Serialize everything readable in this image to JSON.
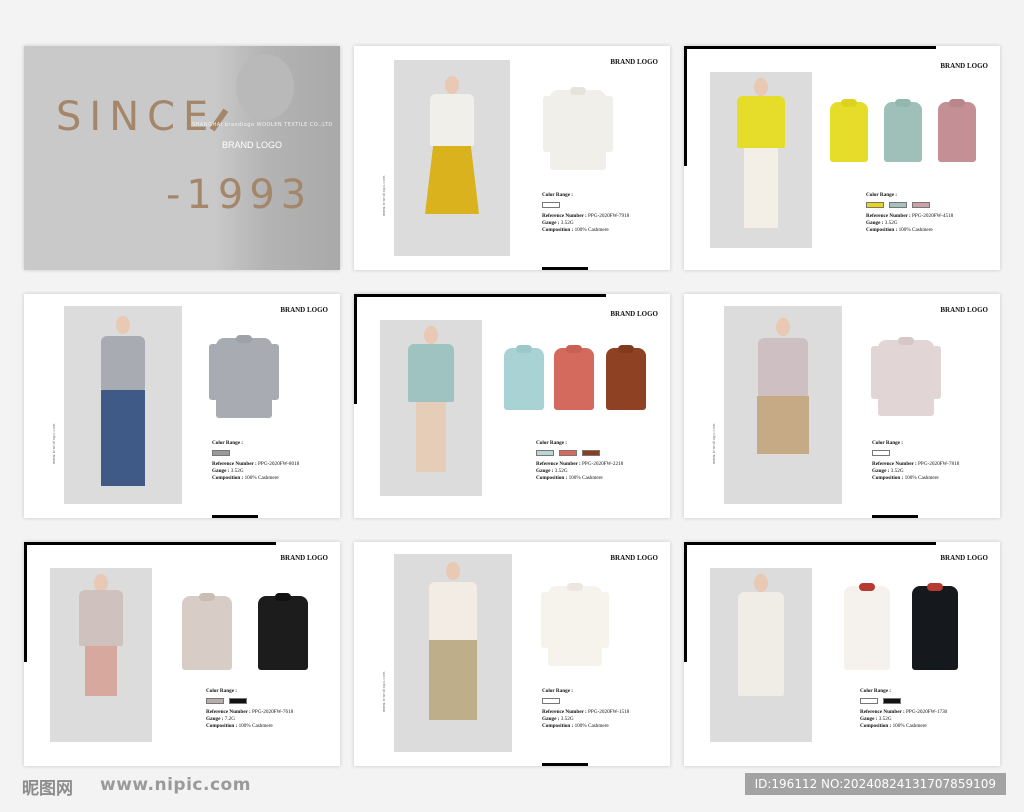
{
  "cover": {
    "since": "SINCE",
    "company": "SHANGHAI brandlogo WOOLEN TEXTILE CO.,LTD",
    "brand": "BRAND LOGO",
    "year": "-1993"
  },
  "brand_logo": "BRAND LOGO",
  "vertical_text": "www.brandlogo.com",
  "labels": {
    "color_range": "Color Range :",
    "reference": "Reference Number :",
    "gauge": "Gauge :",
    "composition": "Composition :"
  },
  "pages": [
    {
      "reference": "PPG-2020FW-7918",
      "gauge": "3.52G",
      "composition": "100% Cashmere",
      "swatches": [
        "#ffffff"
      ],
      "garments": [
        "#f1efe9"
      ],
      "model_top": "#f1efe9",
      "model_bottom": "#d9b21e"
    },
    {
      "reference": "PPG-2020FW-4518",
      "gauge": "3.52G",
      "composition": "100% Cashmere",
      "swatches": [
        "#e9d41b",
        "#a5c3bd",
        "#c9a1a6"
      ],
      "garments": [
        "#e6dc2a",
        "#9ec0b8",
        "#c48f95"
      ],
      "model_top": "#e6dc2a",
      "model_bottom": "#f3efe6"
    },
    {
      "reference": "PPG-2020FW-8018",
      "gauge": "3.52G",
      "composition": "100% Cashmere",
      "swatches": [
        "#9a9a9a"
      ],
      "garments": [
        "#a9abb2"
      ],
      "model_top": "#a9abb2",
      "model_bottom": "#3f5a86"
    },
    {
      "reference": "PPG-2020FW-2218",
      "gauge": "3.52G",
      "composition": "100% Cashmere",
      "swatches": [
        "#b7d6d5",
        "#d9685e",
        "#8b3e22"
      ],
      "garments": [
        "#a9d2d4",
        "#d46a5e",
        "#8e4223"
      ],
      "model_top": "#9ec3c1",
      "model_bottom": "#e6cdb8"
    },
    {
      "reference": "PPG-2020FW-7818",
      "gauge": "3.52G",
      "composition": "100% Cashmere",
      "swatches": [
        "#ffffff"
      ],
      "garments": [
        "#e2d5d6"
      ],
      "model_top": "#cdbfc2",
      "model_bottom": "#c6a985"
    },
    {
      "reference": "PPG-2020FW-7618",
      "gauge": "7.2G",
      "composition": "100% Cashmere",
      "swatches": [
        "#b7adab",
        "#111111"
      ],
      "garments": [
        "#d8ccc6",
        "#1c1c1c"
      ],
      "model_top": "#cfc2be",
      "model_bottom": "#d7a99e"
    },
    {
      "reference": "PPG-2020FW-1518",
      "gauge": "3.52G",
      "composition": "100% Cashmere",
      "swatches": [
        "#ffffff"
      ],
      "garments": [
        "#f6f2ec"
      ],
      "model_top": "#f2ece4",
      "model_bottom": "#bfae8a"
    },
    {
      "reference": "PPG-2020FW-1730",
      "gauge": "3.52G",
      "composition": "100% Cashmere",
      "swatches": [
        "#ffffff",
        "#111111"
      ],
      "garments": [
        "#f5f2ee",
        "#15181c"
      ],
      "model_top": "#f0ece6",
      "model_bottom": "#f0ece6"
    }
  ],
  "watermark": {
    "site": "昵图网",
    "url": "www.nipic.com",
    "id": "ID:196112 NO:20240824131707859109"
  }
}
